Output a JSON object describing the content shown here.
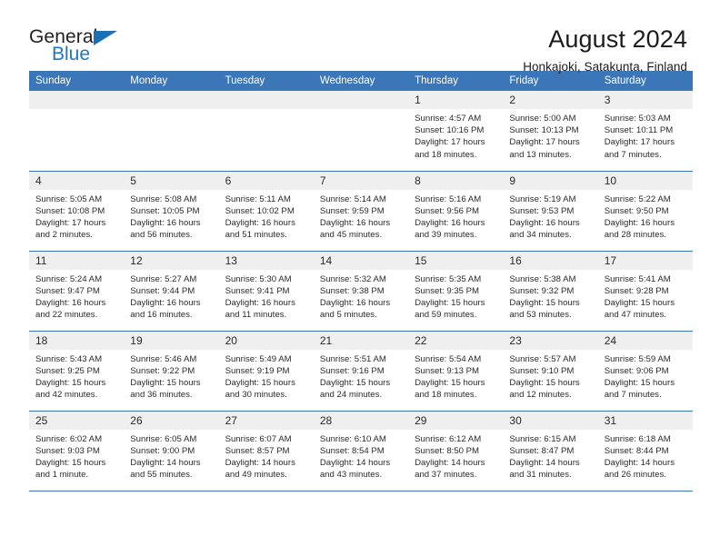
{
  "logo": {
    "primary_text": "General",
    "secondary_text": "Blue",
    "triangle_color": "#1a6fb5",
    "primary_color": "#231f20",
    "secondary_color": "#1f76c2"
  },
  "header": {
    "title": "August 2024",
    "subtitle": "Honkajoki, Satakunta, Finland"
  },
  "theme": {
    "header_bar_color": "#3a76b8",
    "daynum_bg": "#efefef",
    "grid_line": "#3a76b8"
  },
  "calendar": {
    "weekday_headers": [
      "Sunday",
      "Monday",
      "Tuesday",
      "Wednesday",
      "Thursday",
      "Friday",
      "Saturday"
    ],
    "weeks": [
      [
        {
          "day": "",
          "empty": true,
          "sunrise": "",
          "sunset": "",
          "daylight_line1": "",
          "daylight_line2": ""
        },
        {
          "day": "",
          "empty": true,
          "sunrise": "",
          "sunset": "",
          "daylight_line1": "",
          "daylight_line2": ""
        },
        {
          "day": "",
          "empty": true,
          "sunrise": "",
          "sunset": "",
          "daylight_line1": "",
          "daylight_line2": ""
        },
        {
          "day": "",
          "empty": true,
          "sunrise": "",
          "sunset": "",
          "daylight_line1": "",
          "daylight_line2": ""
        },
        {
          "day": "1",
          "empty": false,
          "sunrise": "Sunrise: 4:57 AM",
          "sunset": "Sunset: 10:16 PM",
          "daylight_line1": "Daylight: 17 hours",
          "daylight_line2": "and 18 minutes."
        },
        {
          "day": "2",
          "empty": false,
          "sunrise": "Sunrise: 5:00 AM",
          "sunset": "Sunset: 10:13 PM",
          "daylight_line1": "Daylight: 17 hours",
          "daylight_line2": "and 13 minutes."
        },
        {
          "day": "3",
          "empty": false,
          "sunrise": "Sunrise: 5:03 AM",
          "sunset": "Sunset: 10:11 PM",
          "daylight_line1": "Daylight: 17 hours",
          "daylight_line2": "and 7 minutes."
        }
      ],
      [
        {
          "day": "4",
          "empty": false,
          "sunrise": "Sunrise: 5:05 AM",
          "sunset": "Sunset: 10:08 PM",
          "daylight_line1": "Daylight: 17 hours",
          "daylight_line2": "and 2 minutes."
        },
        {
          "day": "5",
          "empty": false,
          "sunrise": "Sunrise: 5:08 AM",
          "sunset": "Sunset: 10:05 PM",
          "daylight_line1": "Daylight: 16 hours",
          "daylight_line2": "and 56 minutes."
        },
        {
          "day": "6",
          "empty": false,
          "sunrise": "Sunrise: 5:11 AM",
          "sunset": "Sunset: 10:02 PM",
          "daylight_line1": "Daylight: 16 hours",
          "daylight_line2": "and 51 minutes."
        },
        {
          "day": "7",
          "empty": false,
          "sunrise": "Sunrise: 5:14 AM",
          "sunset": "Sunset: 9:59 PM",
          "daylight_line1": "Daylight: 16 hours",
          "daylight_line2": "and 45 minutes."
        },
        {
          "day": "8",
          "empty": false,
          "sunrise": "Sunrise: 5:16 AM",
          "sunset": "Sunset: 9:56 PM",
          "daylight_line1": "Daylight: 16 hours",
          "daylight_line2": "and 39 minutes."
        },
        {
          "day": "9",
          "empty": false,
          "sunrise": "Sunrise: 5:19 AM",
          "sunset": "Sunset: 9:53 PM",
          "daylight_line1": "Daylight: 16 hours",
          "daylight_line2": "and 34 minutes."
        },
        {
          "day": "10",
          "empty": false,
          "sunrise": "Sunrise: 5:22 AM",
          "sunset": "Sunset: 9:50 PM",
          "daylight_line1": "Daylight: 16 hours",
          "daylight_line2": "and 28 minutes."
        }
      ],
      [
        {
          "day": "11",
          "empty": false,
          "sunrise": "Sunrise: 5:24 AM",
          "sunset": "Sunset: 9:47 PM",
          "daylight_line1": "Daylight: 16 hours",
          "daylight_line2": "and 22 minutes."
        },
        {
          "day": "12",
          "empty": false,
          "sunrise": "Sunrise: 5:27 AM",
          "sunset": "Sunset: 9:44 PM",
          "daylight_line1": "Daylight: 16 hours",
          "daylight_line2": "and 16 minutes."
        },
        {
          "day": "13",
          "empty": false,
          "sunrise": "Sunrise: 5:30 AM",
          "sunset": "Sunset: 9:41 PM",
          "daylight_line1": "Daylight: 16 hours",
          "daylight_line2": "and 11 minutes."
        },
        {
          "day": "14",
          "empty": false,
          "sunrise": "Sunrise: 5:32 AM",
          "sunset": "Sunset: 9:38 PM",
          "daylight_line1": "Daylight: 16 hours",
          "daylight_line2": "and 5 minutes."
        },
        {
          "day": "15",
          "empty": false,
          "sunrise": "Sunrise: 5:35 AM",
          "sunset": "Sunset: 9:35 PM",
          "daylight_line1": "Daylight: 15 hours",
          "daylight_line2": "and 59 minutes."
        },
        {
          "day": "16",
          "empty": false,
          "sunrise": "Sunrise: 5:38 AM",
          "sunset": "Sunset: 9:32 PM",
          "daylight_line1": "Daylight: 15 hours",
          "daylight_line2": "and 53 minutes."
        },
        {
          "day": "17",
          "empty": false,
          "sunrise": "Sunrise: 5:41 AM",
          "sunset": "Sunset: 9:28 PM",
          "daylight_line1": "Daylight: 15 hours",
          "daylight_line2": "and 47 minutes."
        }
      ],
      [
        {
          "day": "18",
          "empty": false,
          "sunrise": "Sunrise: 5:43 AM",
          "sunset": "Sunset: 9:25 PM",
          "daylight_line1": "Daylight: 15 hours",
          "daylight_line2": "and 42 minutes."
        },
        {
          "day": "19",
          "empty": false,
          "sunrise": "Sunrise: 5:46 AM",
          "sunset": "Sunset: 9:22 PM",
          "daylight_line1": "Daylight: 15 hours",
          "daylight_line2": "and 36 minutes."
        },
        {
          "day": "20",
          "empty": false,
          "sunrise": "Sunrise: 5:49 AM",
          "sunset": "Sunset: 9:19 PM",
          "daylight_line1": "Daylight: 15 hours",
          "daylight_line2": "and 30 minutes."
        },
        {
          "day": "21",
          "empty": false,
          "sunrise": "Sunrise: 5:51 AM",
          "sunset": "Sunset: 9:16 PM",
          "daylight_line1": "Daylight: 15 hours",
          "daylight_line2": "and 24 minutes."
        },
        {
          "day": "22",
          "empty": false,
          "sunrise": "Sunrise: 5:54 AM",
          "sunset": "Sunset: 9:13 PM",
          "daylight_line1": "Daylight: 15 hours",
          "daylight_line2": "and 18 minutes."
        },
        {
          "day": "23",
          "empty": false,
          "sunrise": "Sunrise: 5:57 AM",
          "sunset": "Sunset: 9:10 PM",
          "daylight_line1": "Daylight: 15 hours",
          "daylight_line2": "and 12 minutes."
        },
        {
          "day": "24",
          "empty": false,
          "sunrise": "Sunrise: 5:59 AM",
          "sunset": "Sunset: 9:06 PM",
          "daylight_line1": "Daylight: 15 hours",
          "daylight_line2": "and 7 minutes."
        }
      ],
      [
        {
          "day": "25",
          "empty": false,
          "sunrise": "Sunrise: 6:02 AM",
          "sunset": "Sunset: 9:03 PM",
          "daylight_line1": "Daylight: 15 hours",
          "daylight_line2": "and 1 minute."
        },
        {
          "day": "26",
          "empty": false,
          "sunrise": "Sunrise: 6:05 AM",
          "sunset": "Sunset: 9:00 PM",
          "daylight_line1": "Daylight: 14 hours",
          "daylight_line2": "and 55 minutes."
        },
        {
          "day": "27",
          "empty": false,
          "sunrise": "Sunrise: 6:07 AM",
          "sunset": "Sunset: 8:57 PM",
          "daylight_line1": "Daylight: 14 hours",
          "daylight_line2": "and 49 minutes."
        },
        {
          "day": "28",
          "empty": false,
          "sunrise": "Sunrise: 6:10 AM",
          "sunset": "Sunset: 8:54 PM",
          "daylight_line1": "Daylight: 14 hours",
          "daylight_line2": "and 43 minutes."
        },
        {
          "day": "29",
          "empty": false,
          "sunrise": "Sunrise: 6:12 AM",
          "sunset": "Sunset: 8:50 PM",
          "daylight_line1": "Daylight: 14 hours",
          "daylight_line2": "and 37 minutes."
        },
        {
          "day": "30",
          "empty": false,
          "sunrise": "Sunrise: 6:15 AM",
          "sunset": "Sunset: 8:47 PM",
          "daylight_line1": "Daylight: 14 hours",
          "daylight_line2": "and 31 minutes."
        },
        {
          "day": "31",
          "empty": false,
          "sunrise": "Sunrise: 6:18 AM",
          "sunset": "Sunset: 8:44 PM",
          "daylight_line1": "Daylight: 14 hours",
          "daylight_line2": "and 26 minutes."
        }
      ]
    ]
  }
}
